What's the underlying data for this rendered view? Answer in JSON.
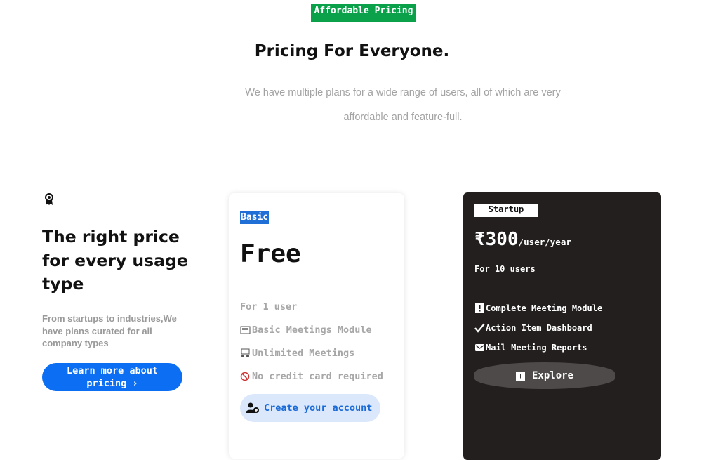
{
  "header": {
    "badge": "Affordable Pricing",
    "title": "Pricing For Everyone.",
    "subtitle": "We have multiple plans for a wide range of users, all of which are very affordable and feature-full."
  },
  "intro": {
    "icon": "award-icon",
    "title": "The right price for every usage type",
    "description": "From startups to industries,We have plans curated for all company types",
    "cta_line1": "Learn more about",
    "cta_line2": "pricing ›"
  },
  "plans": [
    {
      "label": "Basic",
      "price": "Free",
      "users": "For 1 user",
      "features": [
        {
          "icon": "atm-icon",
          "text": "Basic Meetings Module"
        },
        {
          "icon": "meeting-icon",
          "text": "Unlimited Meetings"
        },
        {
          "icon": "no-card-icon",
          "text": "No credit card required"
        }
      ],
      "cta": "Create your account",
      "cta_icon": "add-user-icon"
    },
    {
      "label": "Startup",
      "price": "₹300",
      "period": "/user/year",
      "users": "For 10 users",
      "features": [
        {
          "icon": "alert-icon",
          "text": "Complete Meeting Module"
        },
        {
          "icon": "checkmark-icon",
          "text": "Action Item Dashboard"
        },
        {
          "icon": "mail-icon",
          "text": "Mail Meeting Reports"
        }
      ],
      "cta": "Explore",
      "cta_icon": "plus-icon"
    }
  ],
  "colors": {
    "accent_green": "#0aa14a",
    "primary_blue": "#0b6ef3",
    "dark_card": "#231f1e",
    "muted_text": "#a3a3a3"
  }
}
